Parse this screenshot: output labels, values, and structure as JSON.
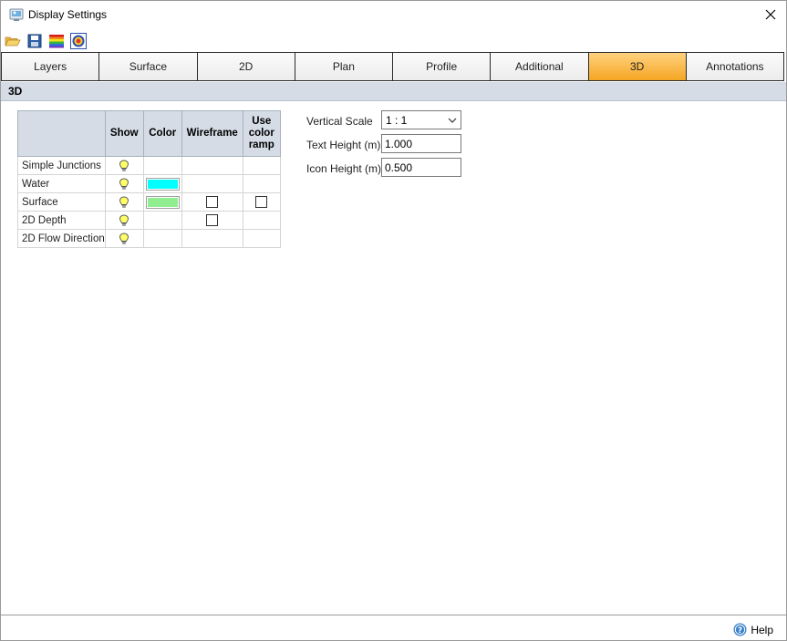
{
  "window": {
    "title": "Display Settings"
  },
  "toolbar": {
    "buttons": [
      {
        "icon": "open-folder-icon"
      },
      {
        "icon": "save-icon"
      },
      {
        "icon": "color-ramp-icon"
      },
      {
        "icon": "palette-icon"
      }
    ]
  },
  "tabs": [
    {
      "label": "Layers",
      "active": false
    },
    {
      "label": "Surface",
      "active": false
    },
    {
      "label": "2D",
      "active": false
    },
    {
      "label": "Plan",
      "active": false
    },
    {
      "label": "Profile",
      "active": false
    },
    {
      "label": "Additional",
      "active": false
    },
    {
      "label": "3D",
      "active": true
    },
    {
      "label": "Annotations",
      "active": false
    }
  ],
  "section": {
    "title": "3D"
  },
  "layers_table": {
    "headers": {
      "show": "Show",
      "color": "Color",
      "wireframe": "Wireframe",
      "ramp": "Use color ramp"
    },
    "rows": [
      {
        "label": "Simple Junctions",
        "show": true,
        "color": null,
        "wireframe": null,
        "ramp": null
      },
      {
        "label": "Water",
        "show": true,
        "color": "#00ffff",
        "wireframe": null,
        "ramp": null
      },
      {
        "label": "Surface",
        "show": true,
        "color": "#90ee90",
        "wireframe": false,
        "ramp": false
      },
      {
        "label": "2D Depth",
        "show": true,
        "color": null,
        "wireframe": false,
        "ramp": null
      },
      {
        "label": "2D Flow Direction",
        "show": true,
        "color": null,
        "wireframe": null,
        "ramp": null
      }
    ]
  },
  "properties": {
    "vertical_scale": {
      "label": "Vertical Scale",
      "value": "1 : 1"
    },
    "text_height": {
      "label": "Text Height (m)",
      "value": "1.000"
    },
    "icon_height": {
      "label": "Icon Height (m)",
      "value": "0.500"
    }
  },
  "footer": {
    "help_label": "Help"
  },
  "colors": {
    "active_tab": "#f5a623",
    "header_bg": "#d5dce6",
    "bulb": "#ffff66"
  }
}
